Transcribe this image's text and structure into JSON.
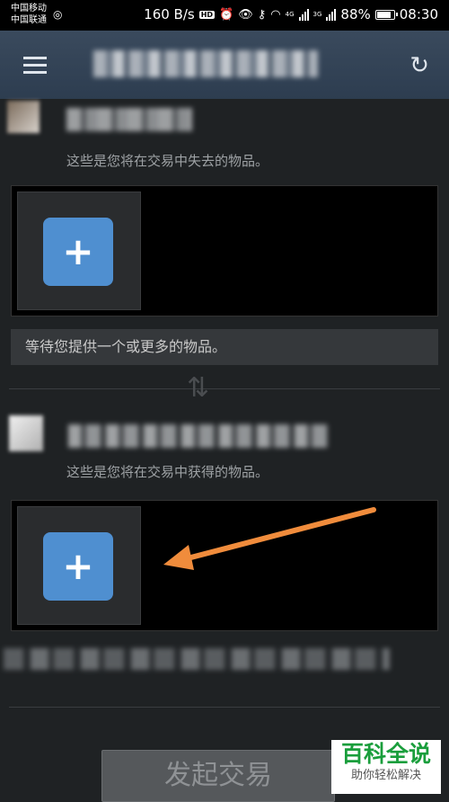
{
  "status_bar": {
    "carrier1": "中国移动",
    "carrier2": "中国联通",
    "speed": "160 B/s",
    "hd": "HD",
    "net4g": "4G",
    "net3g": "3G",
    "battery": "88%",
    "battery_level": 0.88,
    "time": "08:30"
  },
  "header": {
    "title": "",
    "menu_icon": "hamburger-icon",
    "refresh_icon": "refresh-icon"
  },
  "offer": {
    "give_desc": "这些是您将在交易中失去的物品。",
    "waiting": "等待您提供一个或更多的物品。",
    "get_desc": "这些是您将在交易中获得的物品。",
    "add_label": "+"
  },
  "submit_label": "发起交易",
  "watermark": {
    "title": "百科全说",
    "subtitle": "助你轻松解决"
  },
  "colors": {
    "accent": "#4f8fd0",
    "arrow": "#f08c3c"
  }
}
